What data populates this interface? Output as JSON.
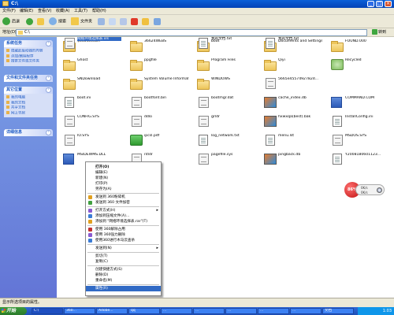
{
  "window": {
    "title": "C:\\"
  },
  "menu": [
    "文件(F)",
    "编辑(E)",
    "查看(V)",
    "收藏(A)",
    "工具(T)",
    "帮助(H)"
  ],
  "toolbar": {
    "back": "后退",
    "search": "搜索",
    "folders": "文件夹"
  },
  "address": {
    "label": "地址(D)",
    "value": "C:\\",
    "go": "转到"
  },
  "sidebar": {
    "system_tasks": {
      "title": "系统任务",
      "items": [
        "隐藏此驱动器的内容",
        "添加/删除程序",
        "搜索文件或文件夹"
      ]
    },
    "file_tasks": {
      "title": "文件和文件夹任务"
    },
    "other_places": {
      "title": "其它位置",
      "items": [
        "我的电脑",
        "我的文档",
        "共享文档",
        "网上邻居"
      ]
    },
    "details": {
      "title": "详细信息"
    }
  },
  "files": [
    {
      "name": "$360Section",
      "type": "folder"
    },
    {
      "name": "36624WEBS",
      "type": "folder"
    },
    {
      "name": "boot",
      "type": "folder"
    },
    {
      "name": "Documents and Settings",
      "type": "folder"
    },
    {
      "name": "FOUND.000",
      "type": "folder"
    },
    {
      "name": "Ghost",
      "type": "folder"
    },
    {
      "name": "ppgfile",
      "type": "folder"
    },
    {
      "name": "Program Files",
      "type": "folder"
    },
    {
      "name": "Qiyi",
      "type": "folder"
    },
    {
      "name": "Recycled",
      "type": "recyc"
    },
    {
      "name": "SNDownload",
      "type": "folder"
    },
    {
      "name": "System Volume Information",
      "type": "folder"
    },
    {
      "name": "WINDOWS",
      "type": "folder"
    },
    {
      "name": "5665e4557492782d...",
      "type": "doc"
    },
    {
      "name": "",
      "type": "none"
    },
    {
      "name": "boot.ini",
      "type": "txt"
    },
    {
      "name": "bootfont.bin",
      "type": "doc"
    },
    {
      "name": "bootmgr.dat",
      "type": "doc"
    },
    {
      "name": "cache_index.db",
      "type": "cube"
    },
    {
      "name": "COMMAND.COM",
      "type": "app"
    },
    {
      "name": "CONFIG.SYS",
      "type": "doc"
    },
    {
      "name": "ddlo",
      "type": "doc"
    },
    {
      "name": "grldr",
      "type": "doc"
    },
    {
      "name": "hxwxqa(best).bak",
      "type": "cube"
    },
    {
      "name": "InstallConfig.ini",
      "type": "txt"
    },
    {
      "name": "IO.SYS",
      "type": "doc"
    },
    {
      "name": "ipcsl.pdf",
      "type": "green"
    },
    {
      "name": "log_network.txt",
      "type": "txt"
    },
    {
      "name": "menu.lst",
      "type": "txt"
    },
    {
      "name": "MSDOS.SYS",
      "type": "doc"
    },
    {
      "name": "MSIDEWMS.DLL",
      "type": "app"
    },
    {
      "name": "ntldr",
      "type": "doc"
    },
    {
      "name": "pagefile.sys",
      "type": "doc"
    },
    {
      "name": "pingback.db",
      "type": "cube"
    },
    {
      "name": "Y2008180601123...",
      "type": "txt"
    },
    {
      "name": "网络环境选择表.xls",
      "type": "doc",
      "selected": true
    },
    {
      "name": "",
      "type": "none"
    },
    {
      "name": "我的文档.txt",
      "type": "txt"
    },
    {
      "name": "我的文档.txt",
      "type": "txt"
    }
  ],
  "context_menu": [
    {
      "label": "打开(O)",
      "bold": true
    },
    {
      "label": "编辑(E)"
    },
    {
      "label": "新建(N)"
    },
    {
      "label": "打印(P)"
    },
    {
      "label": "另存为(A)"
    },
    {
      "sep": true
    },
    {
      "label": "发送到 360粉碎机"
    },
    {
      "label": "发送到 360 文件加密"
    },
    {
      "sep": true
    },
    {
      "label": "打开方式(H)",
      "sub": true
    },
    {
      "label": "添加到压缩文件(A)..."
    },
    {
      "label": "添加到 \"网络环境选择表.rar\"(T)"
    },
    {
      "sep": true
    },
    {
      "label": "使用 360解除占用"
    },
    {
      "label": "使用 360强力删除"
    },
    {
      "label": "使用360进行木马云查杀"
    },
    {
      "sep": true
    },
    {
      "label": "发送到(N)",
      "sub": true
    },
    {
      "sep": true
    },
    {
      "label": "剪切(T)"
    },
    {
      "label": "复制(C)"
    },
    {
      "sep": true
    },
    {
      "label": "创建快捷方式(S)"
    },
    {
      "label": "删除(D)"
    },
    {
      "label": "重命名(M)"
    },
    {
      "sep": true
    },
    {
      "label": "属性(R)",
      "highlight": true
    }
  ],
  "status": "显示所选项目的属性。",
  "speed_widget": {
    "percent": "86%",
    "rx": "0K/s",
    "tx": "0K/s"
  },
  "taskbar": {
    "start": "开始",
    "tasks": [
      "C:\\",
      "360...",
      "Adobe...",
      "qq",
      "...",
      "...",
      "...",
      "...",
      "...",
      "文档"
    ],
    "clock": "1:03"
  }
}
